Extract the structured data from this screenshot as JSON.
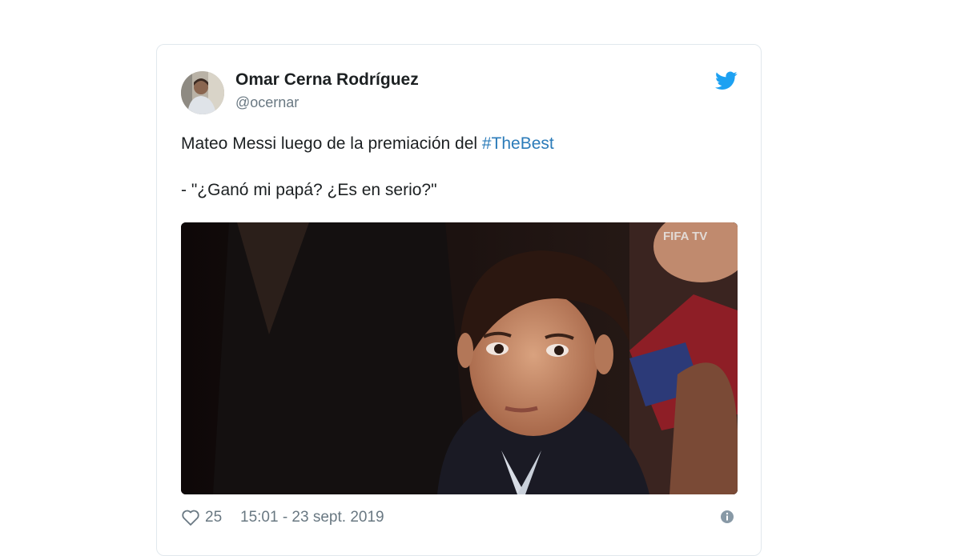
{
  "tweet": {
    "author_name": "Omar Cerna Rodríguez",
    "author_handle": "@ocernar",
    "text_before_hashtag": "Mateo Messi luego de la premiación del ",
    "hashtag": "#TheBest",
    "text_line2": "- \"¿Ganó mi papá? ¿Es en serio?\"",
    "media_watermark": "FIFA TV",
    "likes": "25",
    "timestamp": "15:01 - 23 sept. 2019"
  },
  "icons": {
    "brand": "twitter-bird-icon",
    "like": "heart-icon",
    "info": "info-icon"
  },
  "colors": {
    "brand_blue": "#1da1f2",
    "hashtag": "#2b7bb9",
    "meta_gray": "#697882"
  }
}
